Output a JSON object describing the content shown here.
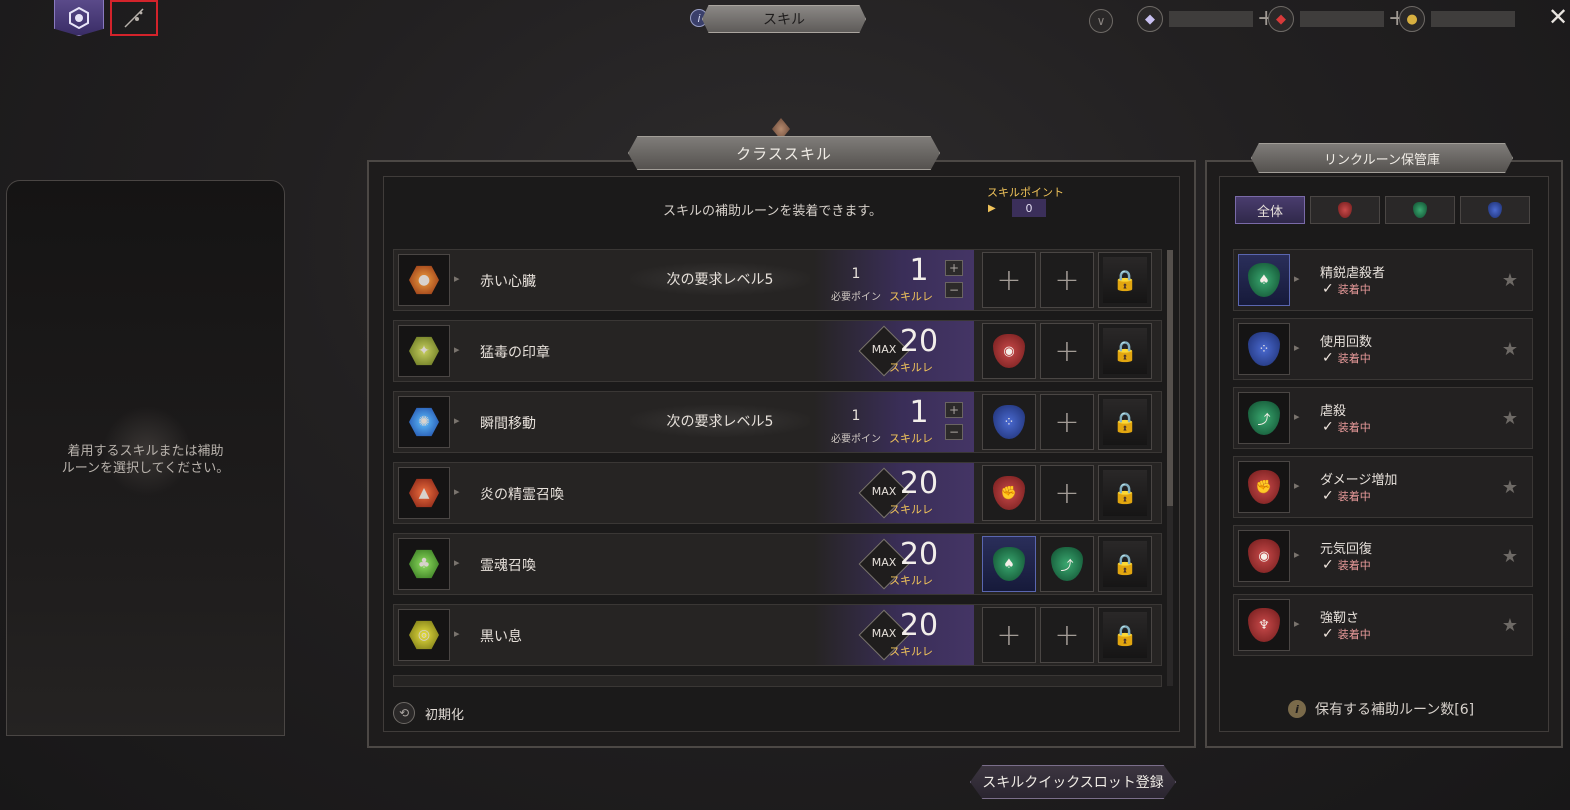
{
  "header": {
    "title": "スキル",
    "info_glyph": "i",
    "close_glyph": "✕",
    "currencies": [
      {
        "icon": "crystal-icon",
        "plus": "+"
      },
      {
        "icon": "ruby-icon",
        "plus": "+"
      },
      {
        "icon": "gold-coin-icon"
      }
    ]
  },
  "left_panel": {
    "hint_line1": "着用するスキルまたは補助",
    "hint_line2": "ルーンを選択してください。"
  },
  "center": {
    "title": "クラススキル",
    "equip_message": "スキルの補助ルーンを装着できます。",
    "skill_points_label": "スキルポイント",
    "skill_points_value": "0",
    "skill_level_label": "スキルレ",
    "required_points_label": "必要ポイン",
    "max_label": "MAX",
    "skills": [
      {
        "name": "赤い心臓",
        "req": "次の要求レベル5",
        "cost": "1",
        "level": "1",
        "max": false,
        "slots": [
          "plus",
          "plus",
          "lock"
        ]
      },
      {
        "name": "猛毒の印章",
        "req": "",
        "cost": "",
        "level": "20",
        "max": true,
        "slots": [
          "rune-red",
          "plus",
          "lock"
        ]
      },
      {
        "name": "瞬間移動",
        "req": "次の要求レベル5",
        "cost": "1",
        "level": "1",
        "max": false,
        "slots": [
          "rune-blue",
          "plus",
          "lock"
        ]
      },
      {
        "name": "炎の精霊召喚",
        "req": "",
        "cost": "",
        "level": "20",
        "max": true,
        "slots": [
          "rune-red",
          "plus",
          "lock"
        ]
      },
      {
        "name": "霊魂召喚",
        "req": "",
        "cost": "",
        "level": "20",
        "max": true,
        "slots": [
          "rune-green-sel",
          "rune-green",
          "lock"
        ]
      },
      {
        "name": "黒い息",
        "req": "",
        "cost": "",
        "level": "20",
        "max": true,
        "slots": [
          "plus",
          "plus",
          "lock"
        ]
      }
    ],
    "reset_label": "初期化",
    "quickslot_label": "スキルクイックスロット登録"
  },
  "right": {
    "title": "リンクルーン保管庫",
    "filters": [
      "全体",
      "red",
      "green",
      "blue"
    ],
    "equipped_label": "装着中",
    "runes": [
      {
        "name": "精鋭虐殺者",
        "color": "green",
        "selected": true
      },
      {
        "name": "使用回数",
        "color": "blue",
        "selected": false
      },
      {
        "name": "虐殺",
        "color": "green",
        "selected": false
      },
      {
        "name": "ダメージ増加",
        "color": "red",
        "selected": false
      },
      {
        "name": "元気回復",
        "color": "red",
        "selected": false
      },
      {
        "name": "強靭さ",
        "color": "red",
        "selected": false
      }
    ],
    "owned_count_label": "保有する補助ルーン数[6]"
  }
}
